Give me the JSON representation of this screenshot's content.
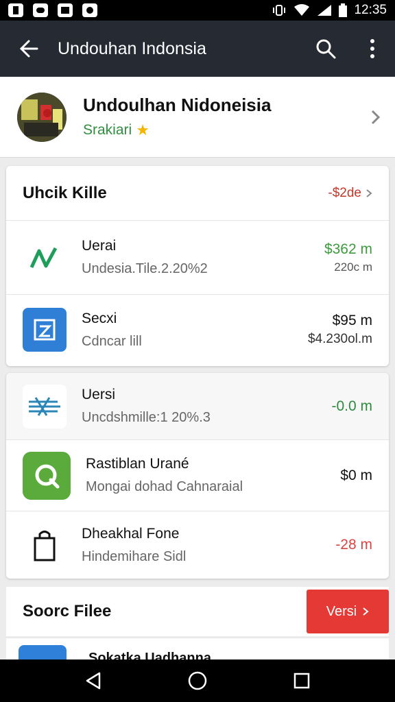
{
  "status_bar": {
    "time": "12:35"
  },
  "app_bar": {
    "title": "Undouhan Indonsia"
  },
  "profile": {
    "name": "Undoulhan Nidoneisia",
    "subtitle": "Srakiari"
  },
  "section1": {
    "title": "Uhcik Kille",
    "link": "-$2de",
    "rows": [
      {
        "title": "Uerai",
        "subtitle": "Undesia.Tile.2.20%2",
        "amount": "$362 m",
        "amount2": "220c m",
        "amount_color": "#3d9a3d"
      },
      {
        "title": "Secxi",
        "subtitle": "Cdncar lill",
        "amount": "$95 m",
        "amount2": "$4.230ol.m",
        "amount_color": "#111111"
      }
    ]
  },
  "section2": {
    "rows": [
      {
        "title": "Uersi",
        "subtitle": "Uncdshmille:1 20%.3",
        "amount": "-0.0 m",
        "amount_color": "#2e8b3d"
      },
      {
        "title": "Rastiblan Urané",
        "subtitle": "Mongai dohad Cahnaraial",
        "amount": "$0 m",
        "amount_color": "#111111"
      },
      {
        "title": "Dheakhal Fone",
        "subtitle": "Hindemihare Sidl",
        "amount": "-28 m",
        "amount_color": "#d64541"
      }
    ]
  },
  "files": {
    "title": "Soorc Filee",
    "button": "Versi",
    "row_title": "Sokatka Uadhanna"
  }
}
